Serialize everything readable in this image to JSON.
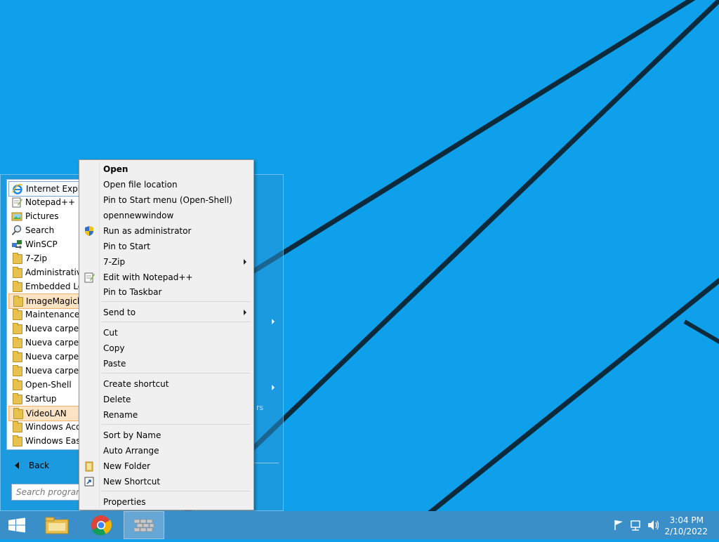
{
  "colors": {
    "desktop_bg": "#0ea0ea",
    "taskbar_bg": "#3b8fc9",
    "menu_bg": "#f0f0f0",
    "selected_bg": "#fbe3c4"
  },
  "start_menu": {
    "programs": [
      {
        "label": "Internet Explorer",
        "icon": "internet-explorer-icon"
      },
      {
        "label": "Notepad++",
        "icon": "notepad-plus-plus-icon"
      },
      {
        "label": "Pictures",
        "icon": "pictures-icon"
      },
      {
        "label": "Search",
        "icon": "search-icon"
      },
      {
        "label": "WinSCP",
        "icon": "winscp-icon"
      },
      {
        "label": "7-Zip",
        "icon": "folder-icon"
      },
      {
        "label": "Administrative",
        "icon": "folder-icon"
      },
      {
        "label": "Embedded Lo",
        "icon": "folder-icon"
      },
      {
        "label": "ImageMagick",
        "icon": "folder-icon"
      },
      {
        "label": "Maintenance",
        "icon": "folder-icon"
      },
      {
        "label": "Nueva carpeta",
        "icon": "folder-icon"
      },
      {
        "label": "Nueva carpeta",
        "icon": "folder-icon"
      },
      {
        "label": "Nueva carpeta",
        "icon": "folder-icon"
      },
      {
        "label": "Nueva carpeta",
        "icon": "folder-icon"
      },
      {
        "label": "Open-Shell",
        "icon": "folder-icon"
      },
      {
        "label": "Startup",
        "icon": "folder-icon"
      },
      {
        "label": "VideoLAN",
        "icon": "folder-icon"
      },
      {
        "label": "Windows Acc",
        "icon": "folder-icon"
      },
      {
        "label": "Windows Ease",
        "icon": "folder-icon"
      }
    ],
    "back_label": "Back",
    "search_placeholder": "Search programs and files",
    "right_pane_fragment": "rs"
  },
  "context_menu": {
    "items": [
      {
        "label": "Open",
        "bold": true
      },
      {
        "label": "Open file location"
      },
      {
        "label": "Pin to Start menu (Open-Shell)"
      },
      {
        "label": "opennewwindow"
      },
      {
        "label": "Run as administrator",
        "icon": "shield-icon"
      },
      {
        "label": "Pin to Start"
      },
      {
        "label": "7-Zip",
        "submenu": true
      },
      {
        "label": "Edit with Notepad++",
        "icon": "notepad-plus-plus-icon"
      },
      {
        "label": "Pin to Taskbar"
      },
      {
        "label": "Send to",
        "submenu": true
      },
      {
        "label": "Cut"
      },
      {
        "label": "Copy"
      },
      {
        "label": "Paste"
      },
      {
        "label": "Create shortcut"
      },
      {
        "label": "Delete"
      },
      {
        "label": "Rename"
      },
      {
        "label": "Sort by Name"
      },
      {
        "label": "Auto Arrange"
      },
      {
        "label": "New Folder",
        "icon": "folder-icon"
      },
      {
        "label": "New Shortcut",
        "icon": "shortcut-icon"
      },
      {
        "label": "Properties"
      }
    ]
  },
  "taskbar": {
    "apps": [
      {
        "name": "file-explorer",
        "icon": "file-explorer-icon"
      },
      {
        "name": "chrome",
        "icon": "chrome-icon"
      },
      {
        "name": "open-shell",
        "icon": "open-shell-icon",
        "active": true
      }
    ],
    "tray": {
      "time": "3:04 PM",
      "date": "2/10/2022"
    }
  }
}
